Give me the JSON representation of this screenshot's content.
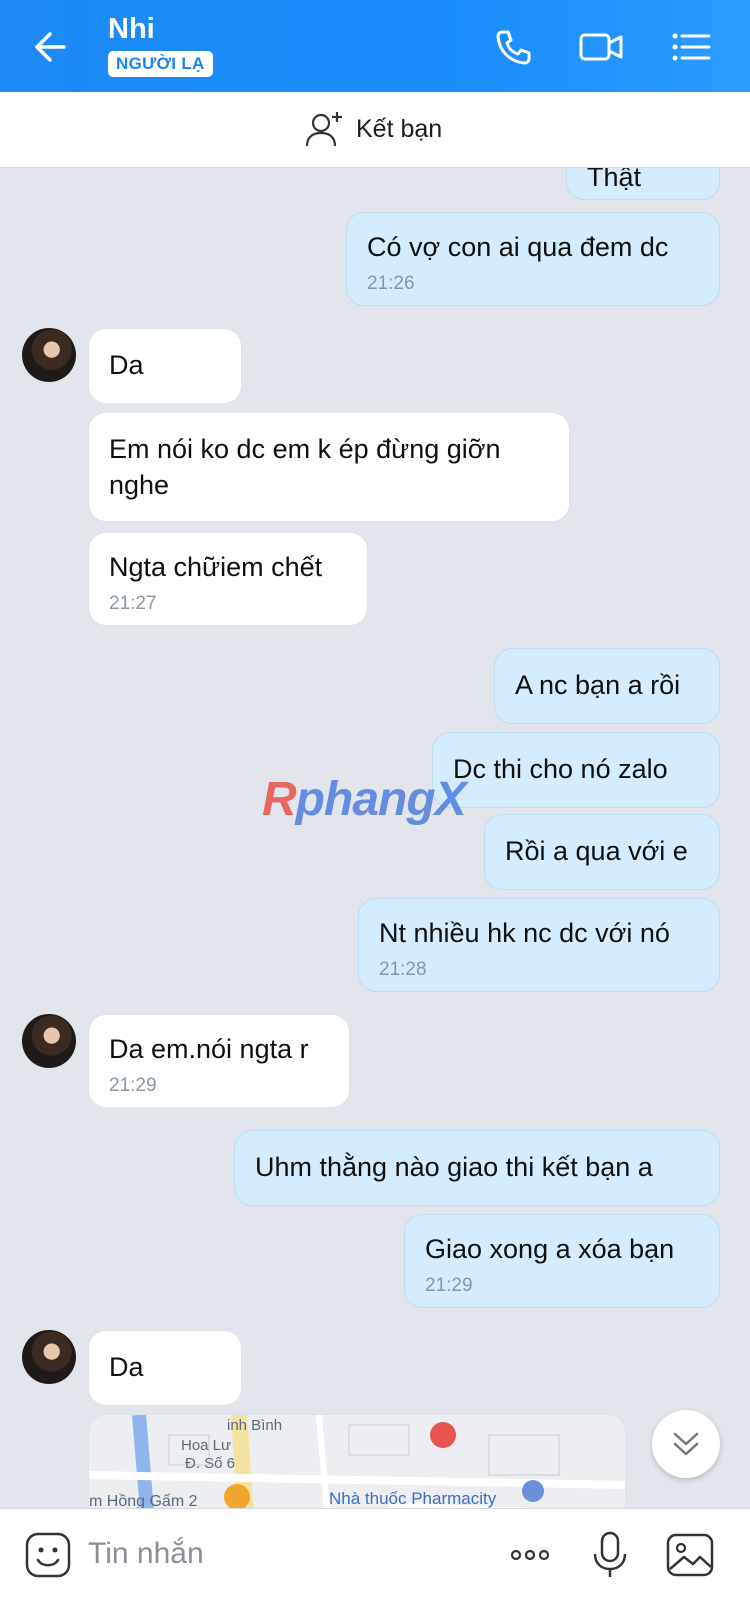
{
  "header": {
    "contact_name": "Nhi",
    "badge": "NGƯỜI LẠ",
    "icons": [
      "back-arrow-icon",
      "phone-icon",
      "video-call-icon",
      "menu-list-icon"
    ]
  },
  "friend_bar": {
    "label": "Kết bạn",
    "icon": "add-friend-icon"
  },
  "messages": [
    {
      "dir": "out",
      "text": "Thật"
    },
    {
      "dir": "out",
      "text": "Có vợ con ai qua đem dc",
      "time": "21:26"
    },
    {
      "dir": "in",
      "text": "Da"
    },
    {
      "dir": "in",
      "text": "Em nói ko dc em k ép đừng giỡn",
      "text2": "nghe"
    },
    {
      "dir": "in",
      "text": "Ngta chữiem chết",
      "time": "21:27"
    },
    {
      "dir": "out",
      "text": "A nc bạn a rồi"
    },
    {
      "dir": "out",
      "text": "Dc thi cho nó zalo"
    },
    {
      "dir": "out",
      "text": "Rồi a qua với e"
    },
    {
      "dir": "out",
      "text": "Nt nhiều hk nc dc với nó",
      "time": "21:28"
    },
    {
      "dir": "in",
      "text": "Da em.nói ngta r",
      "time": "21:29"
    },
    {
      "dir": "out",
      "text": "Uhm thằng nào giao thi kết bạn a"
    },
    {
      "dir": "out",
      "text": "Giao xong a xóa bạn",
      "time": "21:29"
    },
    {
      "dir": "in",
      "text": "Da"
    }
  ],
  "map_preview": {
    "labels": [
      "Hoa Lư",
      "Đ. Số 6",
      "inh Bình",
      "m Hồng Gấm 2",
      "Nhà thuốc Pharmacity"
    ]
  },
  "watermark": {
    "part1": "R",
    "part2": "phangX"
  },
  "input_bar": {
    "placeholder": "Tin nhắn"
  },
  "colors": {
    "header": "#1a8dfb",
    "outgoing_bubble": "#d4ecfd",
    "incoming_bubble": "#ffffff",
    "background": "#e2e6ec"
  }
}
